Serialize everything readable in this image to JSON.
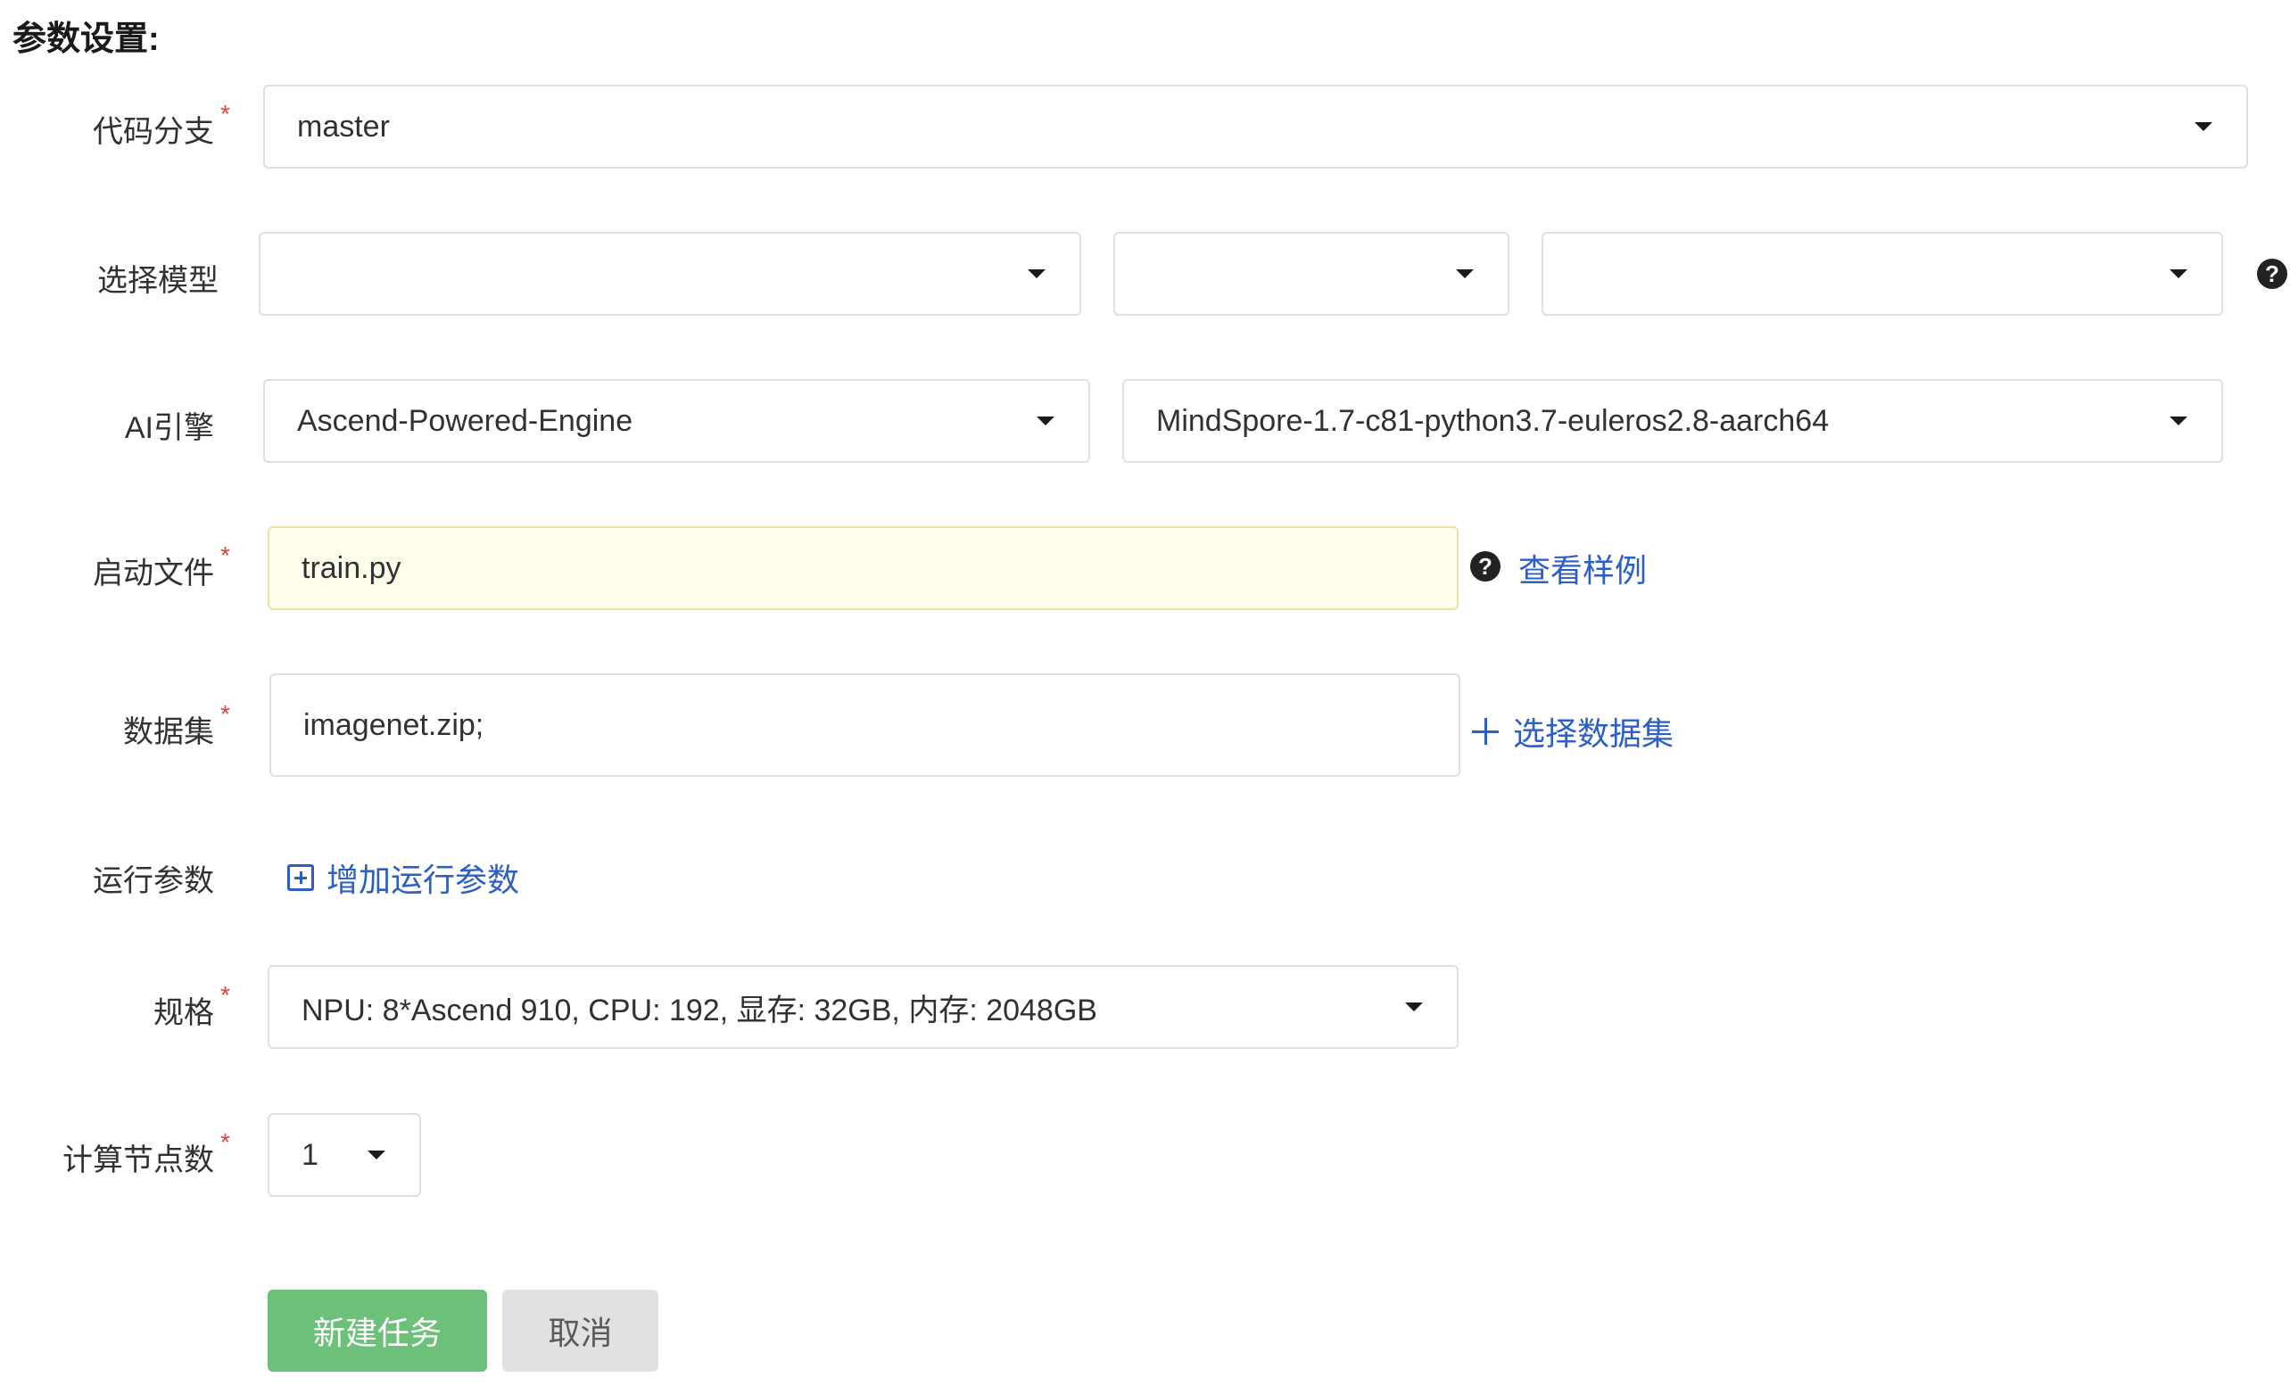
{
  "section_title": "参数设置:",
  "branch": {
    "label": "代码分支",
    "value": "master",
    "required": "*"
  },
  "model": {
    "label": "选择模型",
    "select1": "",
    "select2": "",
    "select3": ""
  },
  "engine": {
    "label": "AI引擎",
    "engine_value": "Ascend-Powered-Engine",
    "image_value": "MindSpore-1.7-c81-python3.7-euleros2.8-aarch64"
  },
  "boot_file": {
    "label": "启动文件",
    "value": "train.py",
    "required": "*",
    "example_link": "查看样例"
  },
  "dataset": {
    "label": "数据集",
    "value": "imagenet.zip;",
    "required": "*",
    "select_link": "选择数据集"
  },
  "run_params": {
    "label": "运行参数",
    "add_link": "增加运行参数"
  },
  "spec": {
    "label": "规格",
    "value": "NPU: 8*Ascend 910, CPU: 192, 显存: 32GB, 内存: 2048GB",
    "required": "*"
  },
  "nodes": {
    "label": "计算节点数",
    "value": "1",
    "required": "*"
  },
  "buttons": {
    "create": "新建任务",
    "cancel": "取消"
  },
  "colors": {
    "link": "#2c5fc4",
    "primary": "#6cc07a",
    "required": "#e0433a",
    "boot_field_bg": "#fefde9"
  },
  "icons": {
    "help": "question-circle-icon",
    "add": "plus-icon",
    "add_box": "plus-square-icon",
    "dropdown": "caret-down-icon"
  }
}
